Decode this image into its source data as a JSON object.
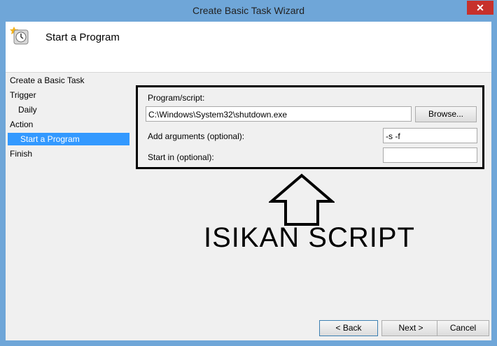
{
  "window": {
    "title": "Create Basic Task Wizard",
    "close_glyph": "✕"
  },
  "header": {
    "title": "Start a Program",
    "icon": "clock-icon"
  },
  "nav": {
    "items": [
      {
        "label": "Create a Basic Task"
      },
      {
        "label": "Trigger"
      },
      {
        "label": "Daily"
      },
      {
        "label": "Action"
      },
      {
        "label": "Start a Program",
        "selected": true
      },
      {
        "label": "Finish"
      }
    ]
  },
  "form": {
    "program_label": "Program/script:",
    "program_value": "C:\\Windows\\System32\\shutdown.exe",
    "browse_label": "Browse...",
    "args_label": "Add arguments (optional):",
    "args_value": "-s -f",
    "start_label": "Start in (optional):",
    "start_value": ""
  },
  "annotation": {
    "text": "ISIKAN SCRIPT"
  },
  "footer": {
    "back_label": "< Back",
    "next_label": "Next >",
    "cancel_label": "Cancel"
  },
  "colors": {
    "selection": "#3399ff",
    "titlebar": "#6fa6d8",
    "close": "#c7312c"
  }
}
